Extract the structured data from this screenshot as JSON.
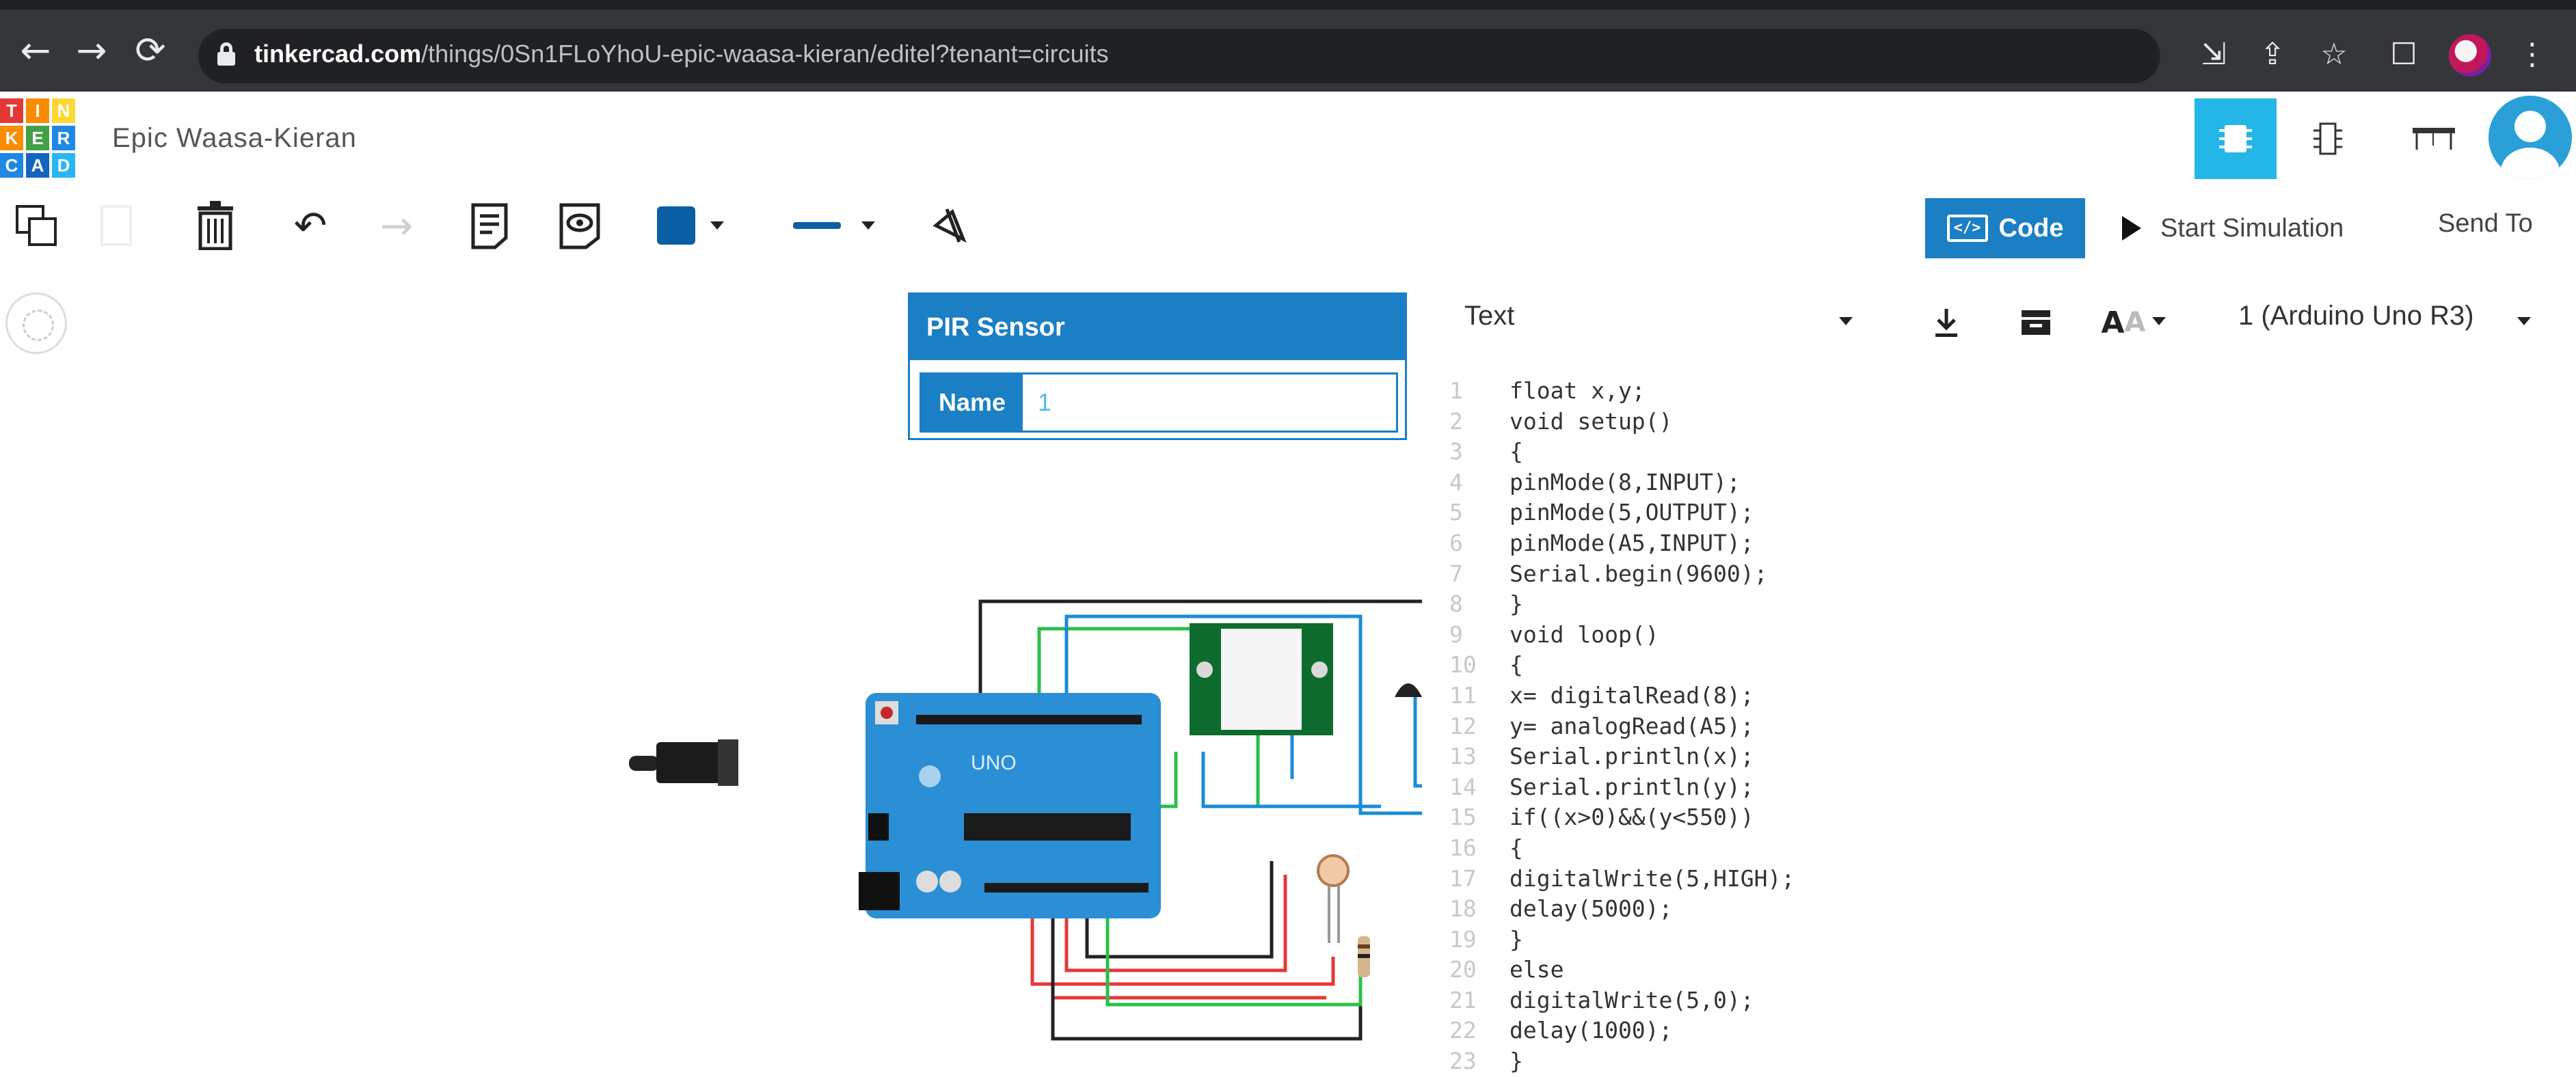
{
  "browser": {
    "url_host": "tinkercad.com",
    "url_path": "/things/0Sn1FLoYhoU-epic-waasa-kieran/editel?tenant=circuits",
    "back_icon": "arrow-left-icon",
    "forward_icon": "arrow-right-icon",
    "reload_icon": "reload-icon"
  },
  "app": {
    "logo_letters": [
      "T",
      "I",
      "N",
      "K",
      "E",
      "R",
      "C",
      "A",
      "D"
    ],
    "design_title": "Epic Waasa-Kieran",
    "view_buttons": [
      "circuit-view-icon",
      "schematic-view-icon",
      "component-list-icon"
    ]
  },
  "toolbar": {
    "code_label": "Code",
    "start_simulation_label": "Start Simulation",
    "send_to_label": "Send To",
    "color_swatch": "#0b5fa5"
  },
  "inspector": {
    "title": "PIR Sensor",
    "name_label": "Name",
    "name_value": "1"
  },
  "code_panel": {
    "mode": "Text",
    "device": "1 (Arduino Uno R3)",
    "lines": [
      {
        "n": "1",
        "t": "float x,y;"
      },
      {
        "n": "2",
        "t": "void setup()"
      },
      {
        "n": "3",
        "t": "{"
      },
      {
        "n": "4",
        "t": "pinMode(8,INPUT);"
      },
      {
        "n": "5",
        "t": "pinMode(5,OUTPUT);"
      },
      {
        "n": "6",
        "t": "pinMode(A5,INPUT);"
      },
      {
        "n": "7",
        "t": "Serial.begin(9600);"
      },
      {
        "n": "8",
        "t": "}"
      },
      {
        "n": "9",
        "t": "void loop()"
      },
      {
        "n": "10",
        "t": "{"
      },
      {
        "n": "11",
        "t": "x= digitalRead(8);"
      },
      {
        "n": "12",
        "t": "y= analogRead(A5);"
      },
      {
        "n": "13",
        "t": "Serial.println(x);"
      },
      {
        "n": "14",
        "t": "Serial.println(y);"
      },
      {
        "n": "15",
        "t": "if((x>0)&&(y<550))"
      },
      {
        "n": "16",
        "t": "{"
      },
      {
        "n": "17",
        "t": "digitalWrite(5,HIGH);"
      },
      {
        "n": "18",
        "t": "delay(5000);"
      },
      {
        "n": "19",
        "t": "}"
      },
      {
        "n": "20",
        "t": "else"
      },
      {
        "n": "21",
        "t": "digitalWrite(5,0);"
      },
      {
        "n": "22",
        "t": "delay(1000);"
      },
      {
        "n": "23",
        "t": "}"
      }
    ]
  },
  "circuit": {
    "board_label": "UNO"
  }
}
